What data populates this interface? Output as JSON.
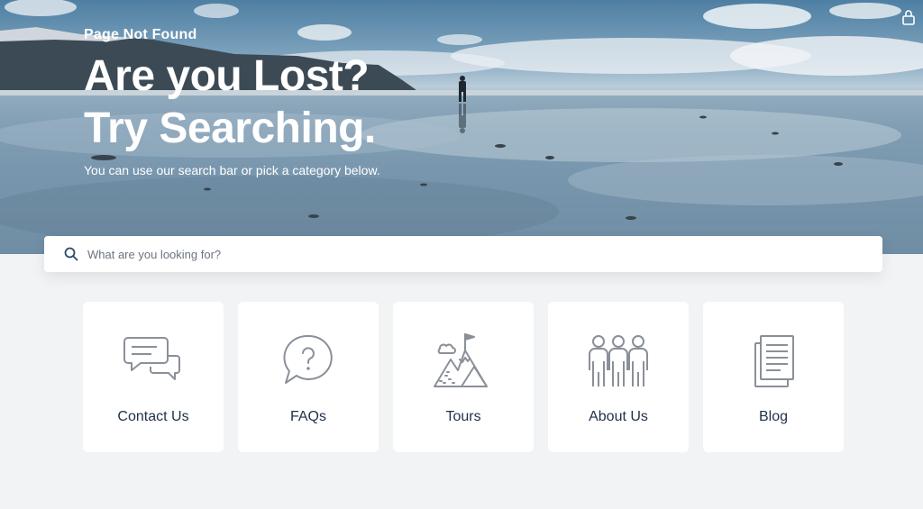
{
  "hero": {
    "eyebrow": "Page Not Found",
    "headline_line1": "Are you Lost?",
    "headline_line2": "Try Searching.",
    "subhead": "You can use our search bar or pick a category below."
  },
  "search": {
    "placeholder": "What are you looking for?",
    "value": ""
  },
  "categories": [
    {
      "label": "Contact Us",
      "icon": "chat-bubbles-icon"
    },
    {
      "label": "FAQs",
      "icon": "question-bubble-icon"
    },
    {
      "label": "Tours",
      "icon": "mountain-flag-icon"
    },
    {
      "label": "About Us",
      "icon": "team-people-icon"
    },
    {
      "label": "Blog",
      "icon": "documents-icon"
    }
  ],
  "colors": {
    "card_text": "#22324a",
    "icon_stroke": "#8a9099",
    "page_bg": "#f2f3f4"
  }
}
